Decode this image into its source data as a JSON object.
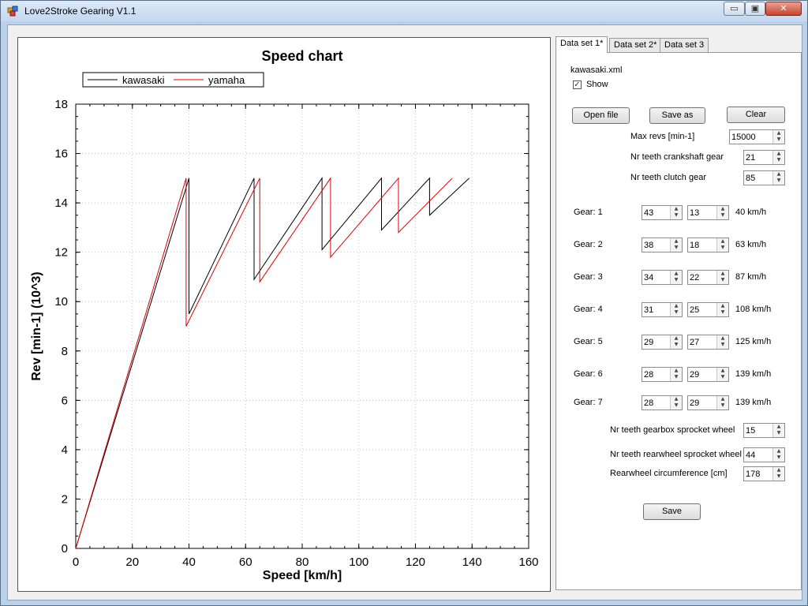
{
  "window": {
    "title": "Love2Stroke Gearing V1.1",
    "min_glyph": "▭",
    "max_glyph": "▣",
    "close_glyph": "✕"
  },
  "tabs": [
    {
      "label": "Data set 1*",
      "active": true
    },
    {
      "label": "Data set 2*",
      "active": false
    },
    {
      "label": "Data set 3",
      "active": false
    }
  ],
  "panel": {
    "filename": "kawasaki.xml",
    "show_label": "Show",
    "show_checked": true,
    "buttons": {
      "open": "Open file",
      "save_as": "Save as",
      "clear": "Clear",
      "save": "Save"
    },
    "max_revs_label": "Max revs [min-1]",
    "max_revs": "15000",
    "crank_label": "Nr teeth crankshaft gear",
    "crank": "21",
    "clutch_label": "Nr teeth clutch gear",
    "clutch": "85",
    "gears": [
      {
        "label": "Gear: 1",
        "a": "43",
        "b": "13",
        "speed": "40 km/h"
      },
      {
        "label": "Gear: 2",
        "a": "38",
        "b": "18",
        "speed": "63 km/h"
      },
      {
        "label": "Gear: 3",
        "a": "34",
        "b": "22",
        "speed": "87 km/h"
      },
      {
        "label": "Gear: 4",
        "a": "31",
        "b": "25",
        "speed": "108 km/h"
      },
      {
        "label": "Gear: 5",
        "a": "29",
        "b": "27",
        "speed": "125 km/h"
      },
      {
        "label": "Gear: 6",
        "a": "28",
        "b": "29",
        "speed": "139 km/h"
      },
      {
        "label": "Gear: 7",
        "a": "28",
        "b": "29",
        "speed": "139 km/h"
      }
    ],
    "gearbox_label": "Nr teeth gearbox sprocket wheel",
    "gearbox": "15",
    "rearwheel_label": "Nr teeth rearwheel sprocket wheel",
    "rearwheel": "44",
    "circ_label": "Rearwheel circumference [cm]",
    "circ": "178"
  },
  "chart_data": {
    "type": "line",
    "title": "Speed chart",
    "xlabel": "Speed [km/h]",
    "ylabel": "Rev [min-1] (10^3)",
    "xlim": [
      0,
      160
    ],
    "ylim": [
      0,
      18
    ],
    "xticks": [
      "0",
      "20",
      "40",
      "60",
      "80",
      "100",
      "120",
      "140",
      "160"
    ],
    "yticks": [
      "0",
      "2",
      "4",
      "6",
      "8",
      "10",
      "12",
      "14",
      "16",
      "18"
    ],
    "grid": true,
    "legend": "top-left",
    "series": [
      {
        "name": "kawasaki",
        "color": "#000000",
        "points": [
          [
            0,
            0
          ],
          [
            40,
            15
          ],
          [
            40,
            9.5
          ],
          [
            63,
            15
          ],
          [
            63,
            10.9
          ],
          [
            87,
            15
          ],
          [
            87,
            12.1
          ],
          [
            108,
            15
          ],
          [
            108,
            12.9
          ],
          [
            125,
            15
          ],
          [
            125,
            13.5
          ],
          [
            139,
            15
          ]
        ]
      },
      {
        "name": "yamaha",
        "color": "#e00000",
        "points": [
          [
            0,
            0
          ],
          [
            39,
            15
          ],
          [
            39,
            9
          ],
          [
            65,
            15
          ],
          [
            65,
            10.8
          ],
          [
            90,
            15
          ],
          [
            90,
            11.8
          ],
          [
            114,
            15
          ],
          [
            114,
            12.8
          ],
          [
            133,
            15
          ]
        ]
      }
    ]
  }
}
